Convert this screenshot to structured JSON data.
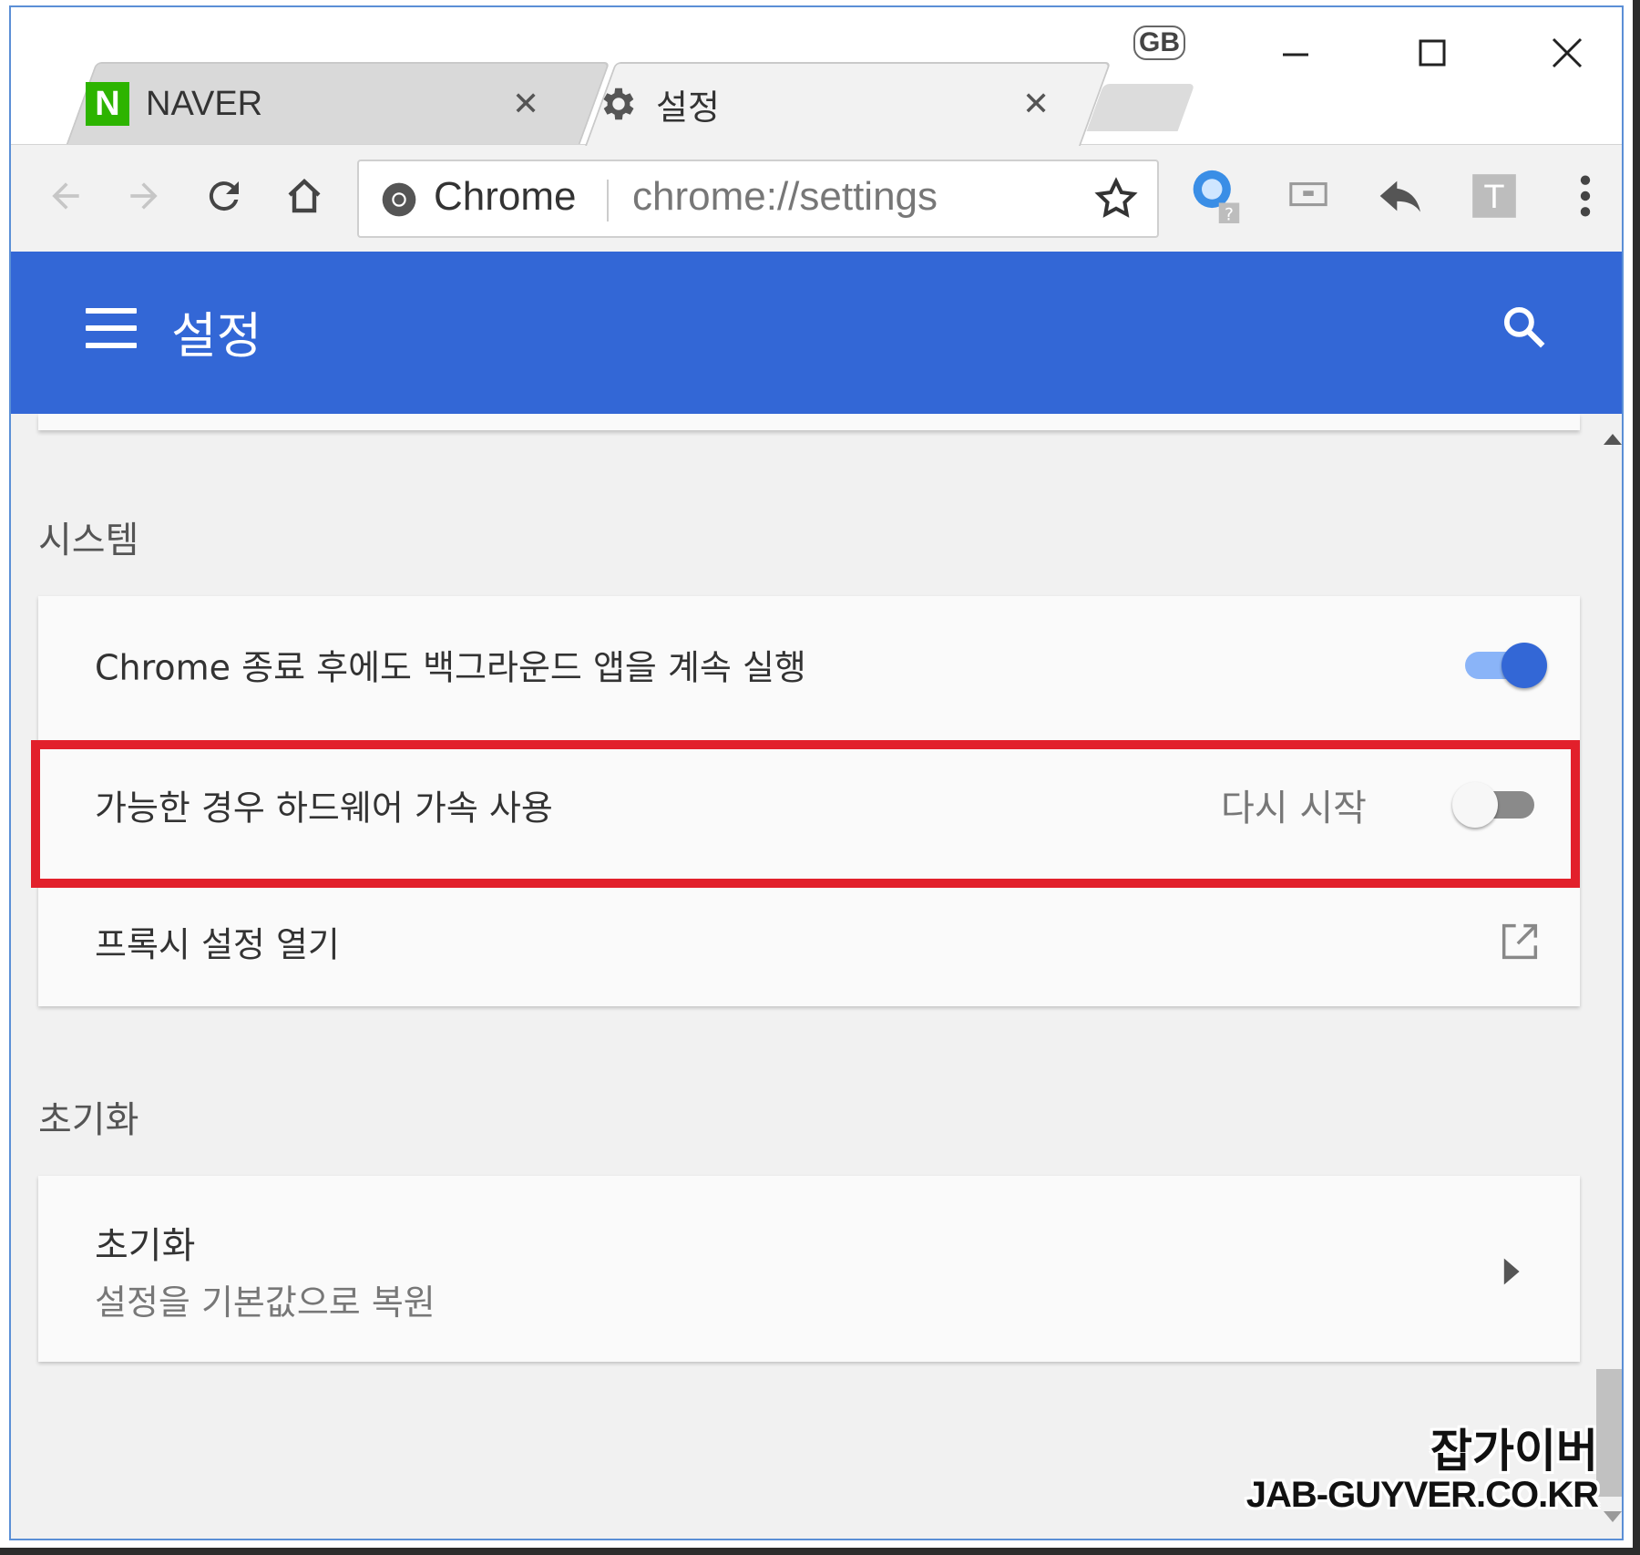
{
  "window": {
    "keyboard_badge": "GB",
    "controls": {
      "minimize": "minimize-icon",
      "maximize": "maximize-icon",
      "close": "close-icon"
    }
  },
  "tabs": [
    {
      "title": "NAVER",
      "favicon": "N",
      "favicon_color": "#2db400",
      "active": false
    },
    {
      "title": "설정",
      "favicon": "gear-icon",
      "active": true
    }
  ],
  "toolbar": {
    "origin_chip": "Chrome",
    "url": "chrome://settings",
    "icons": [
      "back-arrow-icon",
      "forward-arrow-icon",
      "reload-icon",
      "home-icon",
      "bookmark-star-icon",
      "extension-globe-icon",
      "extension-screen-icon",
      "reply-icon",
      "extension-t-icon",
      "menu-kebab-icon"
    ]
  },
  "header": {
    "title": "설정",
    "color": "#3367d6"
  },
  "sections": {
    "system": {
      "title": "시스템",
      "rows": [
        {
          "label": "Chrome 종료 후에도 백그라운드 앱을 계속 실행",
          "enabled": true
        },
        {
          "label": "가능한 경우 하드웨어 가속 사용",
          "action": "다시 시작",
          "enabled": false
        },
        {
          "label": "프록시 설정 열기"
        }
      ]
    },
    "reset": {
      "title": "초기화",
      "item_title": "초기화",
      "item_subtitle": "설정을 기본값으로 복원"
    }
  },
  "highlight_color": "#e2202b",
  "watermark": {
    "line1": "잡가이버",
    "line2": "JAB-GUYVER.CO.KR"
  }
}
